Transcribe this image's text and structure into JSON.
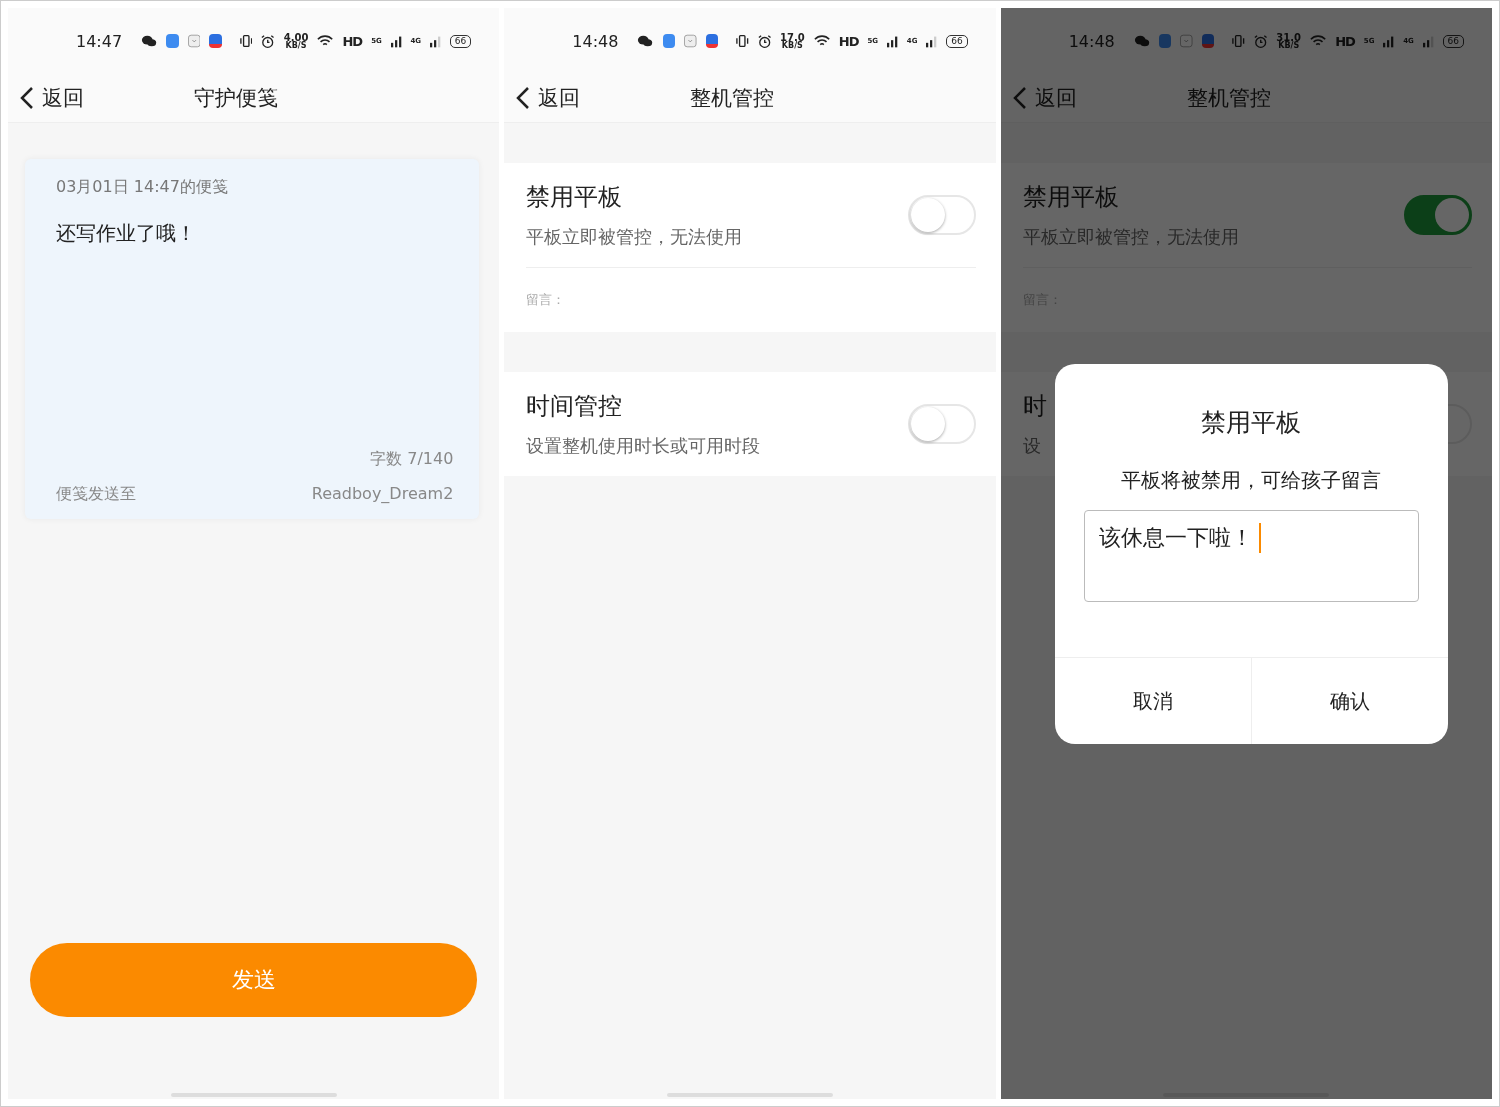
{
  "screens": [
    {
      "kind": "note",
      "status": {
        "time": "14:47",
        "speed": "4.00",
        "speed_unit": "KB/S",
        "hd": "HD",
        "net1": "5G",
        "net2": "4G",
        "battery": "66"
      },
      "nav": {
        "back": "返回",
        "title": "守护便笺"
      },
      "note": {
        "date": "03月01日  14:47的便笺",
        "body": "还写作业了哦！",
        "count": "字数 7/140",
        "to_label": "便笺发送至",
        "to_value": "Readboy_Dream2"
      },
      "send": "发送"
    },
    {
      "kind": "control",
      "status": {
        "time": "14:48",
        "speed": "17.0",
        "speed_unit": "KB/S",
        "hd": "HD",
        "net1": "5G",
        "net2": "4G",
        "battery": "66"
      },
      "nav": {
        "back": "返回",
        "title": "整机管控"
      },
      "settings": [
        {
          "title": "禁用平板",
          "subtitle": "平板立即被管控，无法使用",
          "on": false,
          "note_label": "留言："
        },
        {
          "title": "时间管控",
          "subtitle": "设置整机使用时长或可用时段",
          "on": false
        }
      ]
    },
    {
      "kind": "control",
      "status": {
        "time": "14:48",
        "speed": "31.0",
        "speed_unit": "KB/S",
        "hd": "HD",
        "net1": "5G",
        "net2": "4G",
        "battery": "66"
      },
      "nav": {
        "back": "返回",
        "title": "整机管控"
      },
      "settings": [
        {
          "title": "禁用平板",
          "subtitle": "平板立即被管控，无法使用",
          "on": true,
          "note_label": "留言："
        },
        {
          "title": "时",
          "subtitle": "设",
          "on": false
        }
      ],
      "dialog": {
        "title": "禁用平板",
        "message": "平板将被禁用，可给孩子留言",
        "value": "该休息一下啦！",
        "buttons": [
          "取消",
          "确认"
        ]
      }
    }
  ]
}
